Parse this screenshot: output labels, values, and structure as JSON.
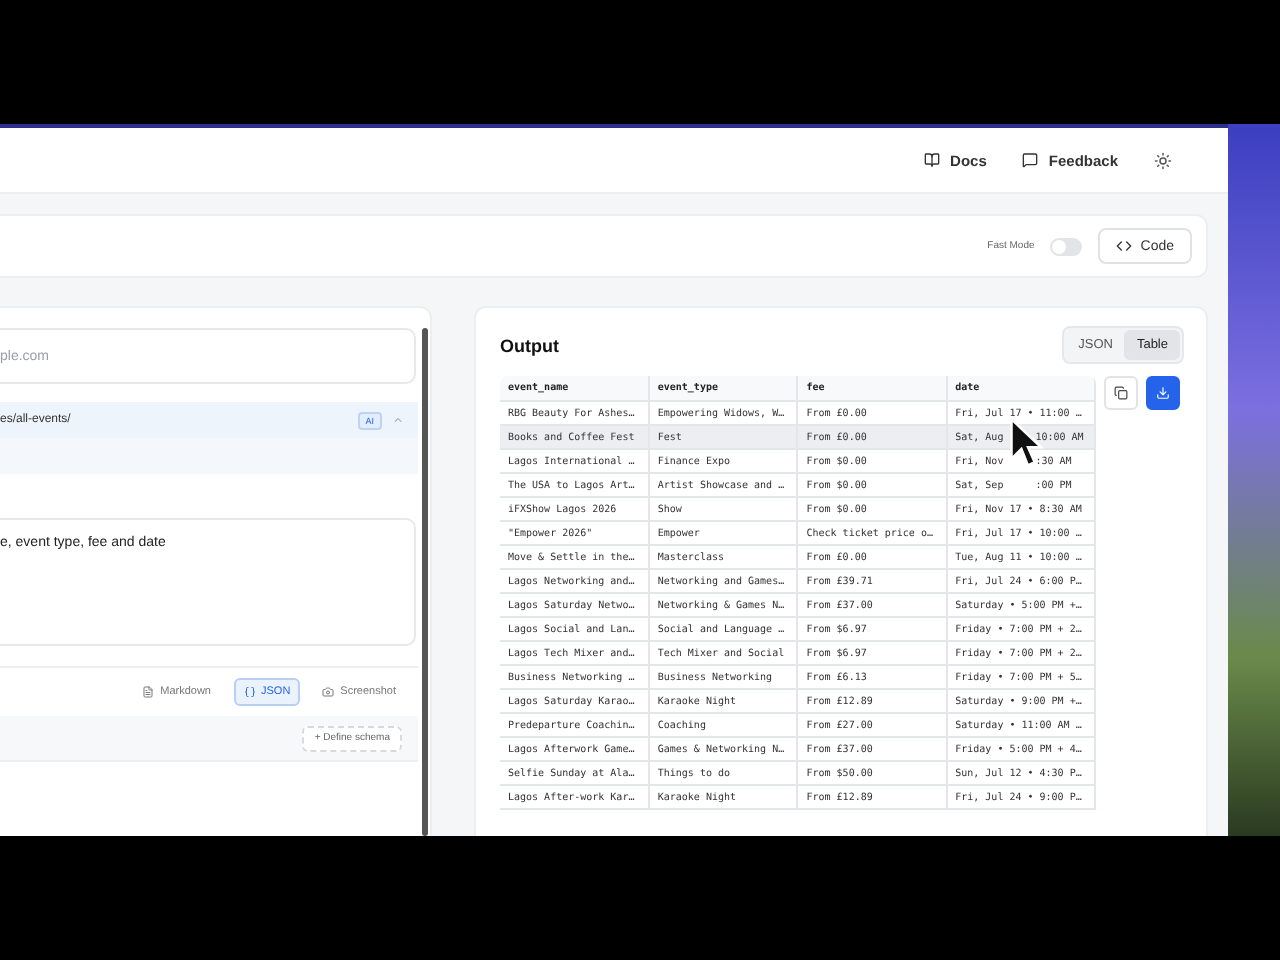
{
  "header": {
    "links": [
      {
        "kind": "docs",
        "label": "Docs"
      },
      {
        "kind": "feedback",
        "label": "Feedback"
      }
    ]
  },
  "toolbar": {
    "fast_mode": {
      "label": "Fast Mode",
      "on": false
    },
    "code_button": "Code"
  },
  "input_panel": {
    "url_field": {
      "placeholder": "ple.com"
    },
    "link_row": {
      "text": "es/all-events/",
      "badge": "AI",
      "expanded": true
    },
    "prompt": {
      "value": "e, event type, fee and date"
    },
    "formats": [
      {
        "kind": "markdown",
        "label": "Markdown",
        "selected": false
      },
      {
        "kind": "json",
        "label": "JSON",
        "selected": true
      },
      {
        "kind": "screenshot",
        "label": "Screenshot",
        "selected": false
      }
    ],
    "define_schema": "+ Define schema"
  },
  "output": {
    "title": "Output",
    "view_tabs": [
      {
        "label": "JSON",
        "selected": false
      },
      {
        "label": "Table",
        "selected": true
      }
    ],
    "table": {
      "columns": [
        "event_name",
        "event_type",
        "fee",
        "date"
      ],
      "rows": [
        {
          "highlighted": false,
          "cells": [
            "RBG Beauty For Ashes…",
            "Empowering Widows, W…",
            "From £0.00",
            [
              "Fri, Jul 17 • 11:00 …"
            ]
          ]
        },
        {
          "highlighted": true,
          "cells": [
            "Books and Coffee Fest",
            "Fest",
            "From £0.00",
            [
              "Sat, Aug",
              "10:00 AM"
            ]
          ]
        },
        {
          "highlighted": false,
          "cells": [
            "Lagos International …",
            "Finance Expo",
            "From $0.00",
            [
              "Fri, Nov",
              ":30 AM"
            ]
          ]
        },
        {
          "highlighted": false,
          "cells": [
            "The USA to Lagos Art…",
            "Artist Showcase and …",
            "From $0.00",
            [
              "Sat, Sep",
              ":00 PM"
            ]
          ]
        },
        {
          "highlighted": false,
          "cells": [
            "iFXShow Lagos 2026",
            "Show",
            "From $0.00",
            [
              "Fri, Nov 17 • 8:30 AM"
            ]
          ]
        },
        {
          "highlighted": false,
          "cells": [
            "\"Empower 2026\"",
            "Empower",
            "Check ticket price o…",
            [
              "Fri, Jul 17 • 10:00 …"
            ]
          ]
        },
        {
          "highlighted": false,
          "cells": [
            "Move & Settle in the…",
            "Masterclass",
            "From £0.00",
            [
              "Tue, Aug 11 • 10:00 …"
            ]
          ]
        },
        {
          "highlighted": false,
          "cells": [
            "Lagos Networking and…",
            "Networking and Games…",
            "From £39.71",
            [
              "Fri, Jul 24 • 6:00 P…"
            ]
          ]
        },
        {
          "highlighted": false,
          "cells": [
            "Lagos Saturday Netwo…",
            "Networking & Games N…",
            "From £37.00",
            [
              "Saturday • 5:00 PM +…"
            ]
          ]
        },
        {
          "highlighted": false,
          "cells": [
            "Lagos Social and Lan…",
            "Social and Language …",
            "From $6.97",
            [
              "Friday • 7:00 PM + 2…"
            ]
          ]
        },
        {
          "highlighted": false,
          "cells": [
            "Lagos Tech Mixer and…",
            "Tech Mixer and Social",
            "From $6.97",
            [
              "Friday • 7:00 PM + 2…"
            ]
          ]
        },
        {
          "highlighted": false,
          "cells": [
            "Business Networking …",
            "Business Networking",
            "From £6.13",
            [
              "Friday • 7:00 PM + 5…"
            ]
          ]
        },
        {
          "highlighted": false,
          "cells": [
            "Lagos Saturday Karao…",
            "Karaoke Night",
            "From £12.89",
            [
              "Saturday • 9:00 PM +…"
            ]
          ]
        },
        {
          "highlighted": false,
          "cells": [
            "Predeparture Coachin…",
            "Coaching",
            "From £27.00",
            [
              "Saturday • 11:00 AM …"
            ]
          ]
        },
        {
          "highlighted": false,
          "cells": [
            "Lagos Afterwork Game…",
            "Games & Networking N…",
            "From £37.00",
            [
              "Friday • 5:00 PM + 4…"
            ]
          ]
        },
        {
          "highlighted": false,
          "cells": [
            "Selfie Sunday at Ala…",
            "Things to do",
            "From $50.00",
            [
              "Sun, Jul 12 • 4:30 P…"
            ]
          ]
        },
        {
          "highlighted": false,
          "cells": [
            "Lagos After-work Kar…",
            "Karaoke Night",
            "From £12.89",
            [
              "Fri, Jul 24 • 9:00 P…"
            ]
          ]
        }
      ]
    }
  }
}
